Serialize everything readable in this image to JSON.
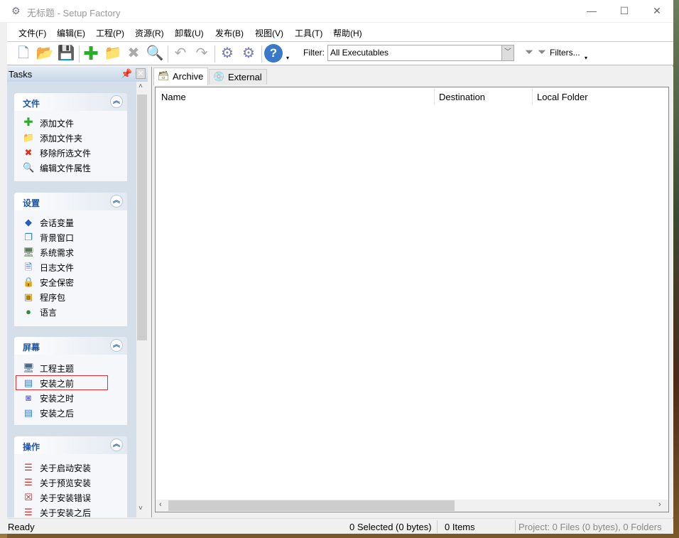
{
  "window": {
    "title": "无标题 - Setup Factory",
    "minimize": "—",
    "maximize": "☐",
    "close": "✕"
  },
  "menu": [
    "文件(F)",
    "编辑(E)",
    "工程(P)",
    "资源(R)",
    "卸载(U)",
    "发布(B)",
    "视图(V)",
    "工具(T)",
    "帮助(H)"
  ],
  "toolbar": {
    "icons": [
      "new-project-icon",
      "open-project-icon",
      "save-icon",
      "add-file-icon",
      "add-folder-icon",
      "remove-icon",
      "file-properties-icon",
      "undo-icon",
      "redo-icon",
      "build-icon",
      "settings-icon",
      "help-icon"
    ],
    "filter_label": "Filter:",
    "filter_value": "All Executables",
    "filters_button": "Filters..."
  },
  "tasks": {
    "title": "Tasks",
    "groups": [
      {
        "title": "文件",
        "items": [
          "添加文件",
          "添加文件夹",
          "移除所选文件",
          "编辑文件属性"
        ]
      },
      {
        "title": "设置",
        "items": [
          "会话变量",
          "背景窗口",
          "系统需求",
          "日志文件",
          "安全保密",
          "程序包",
          "语言"
        ]
      },
      {
        "title": "屏幕",
        "items": [
          "工程主题",
          "安装之前",
          "安装之时",
          "安装之后"
        ]
      },
      {
        "title": "操作",
        "items": [
          "关于启动安装",
          "关于预览安装",
          "关于安装错误",
          "关于安装之后"
        ]
      }
    ]
  },
  "tabs": [
    "Archive",
    "External"
  ],
  "columns": [
    "Name",
    "Destination",
    "Local Folder"
  ],
  "status": {
    "ready": "Ready",
    "selected": "0 Selected (0 bytes)",
    "items": "0 Items",
    "project": "Project: 0 Files (0 bytes), 0 Folders"
  }
}
